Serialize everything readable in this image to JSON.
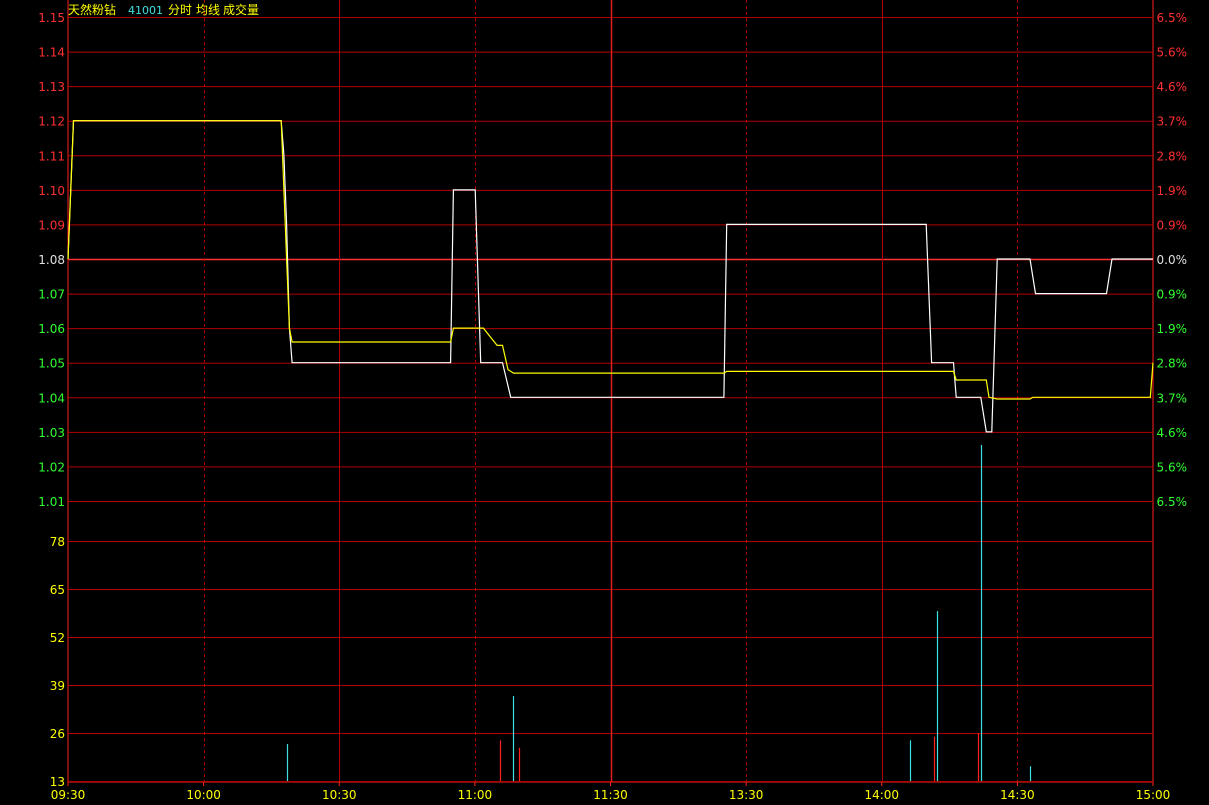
{
  "header": {
    "stock_name": "天然粉钻",
    "stock_code": "41001",
    "view_mode": "分时",
    "avg_line_label": "均线",
    "volume_label": "成交量"
  },
  "colors": {
    "grid": "#b00000",
    "axis": "#ff2020",
    "up": "#ff3030",
    "down": "#30ff30",
    "neutral": "#e0e0e0",
    "price_line": "#ffffff",
    "avg_line": "#ffff00",
    "vol_up": "#ff2020",
    "vol_down": "#40e0e0",
    "volume_tick": "#ffff00",
    "header_name": "#ffff00",
    "header_code": "#40e0e0",
    "header_text": "#ffff00"
  },
  "chart_data": {
    "type": "line",
    "prev_close": 1.08,
    "x_ticks": [
      "09:30",
      "10:00",
      "10:30",
      "11:00",
      "11:30",
      "13:30",
      "14:00",
      "14:30",
      "15:00"
    ],
    "y_ticks_price": [
      1.15,
      1.14,
      1.13,
      1.12,
      1.11,
      1.1,
      1.09,
      1.08,
      1.07,
      1.06,
      1.05,
      1.04,
      1.03,
      1.02,
      1.01
    ],
    "y_ticks_pct": [
      "6.5%",
      "5.6%",
      "4.6%",
      "3.7%",
      "2.8%",
      "1.9%",
      "0.9%",
      "0.0%",
      "0.9%",
      "1.9%",
      "2.8%",
      "3.7%",
      "4.6%",
      "5.6%",
      "6.5%"
    ],
    "ylim": [
      1.01,
      1.15
    ],
    "volume_ticks": [
      78,
      65,
      52,
      39,
      26,
      13
    ],
    "volume_max": 91,
    "series": [
      {
        "points": [
          [
            0,
            1.08
          ],
          [
            2,
            1.12
          ],
          [
            78,
            1.12
          ],
          [
            79,
            1.11
          ],
          [
            80,
            1.09
          ],
          [
            81,
            1.06
          ],
          [
            82,
            1.05
          ],
          [
            140,
            1.05
          ],
          [
            141,
            1.1
          ],
          [
            149,
            1.1
          ],
          [
            151,
            1.05
          ],
          [
            159,
            1.05
          ],
          [
            162,
            1.04
          ],
          [
            240,
            1.04
          ],
          [
            241,
            1.09
          ],
          [
            314,
            1.09
          ],
          [
            316,
            1.05
          ],
          [
            324,
            1.05
          ],
          [
            325,
            1.04
          ],
          [
            334,
            1.04
          ],
          [
            336,
            1.03
          ],
          [
            338,
            1.03
          ],
          [
            340,
            1.08
          ],
          [
            352,
            1.08
          ],
          [
            354,
            1.07
          ],
          [
            380,
            1.07
          ],
          [
            382,
            1.08
          ],
          [
            397,
            1.08
          ]
        ]
      },
      {
        "points": [
          [
            0,
            1.08
          ],
          [
            2,
            1.12
          ],
          [
            78,
            1.12
          ],
          [
            79,
            1.1
          ],
          [
            80,
            1.08
          ],
          [
            81,
            1.06
          ],
          [
            82,
            1.056
          ],
          [
            140,
            1.056
          ],
          [
            141,
            1.06
          ],
          [
            152,
            1.06
          ],
          [
            153,
            1.059
          ],
          [
            157,
            1.055
          ],
          [
            159,
            1.055
          ],
          [
            161,
            1.048
          ],
          [
            163,
            1.047
          ],
          [
            240,
            1.047
          ],
          [
            241,
            1.0475
          ],
          [
            324,
            1.0475
          ],
          [
            325,
            1.045
          ],
          [
            336,
            1.045
          ],
          [
            337,
            1.04
          ],
          [
            340,
            1.0395
          ],
          [
            352,
            1.0395
          ],
          [
            353,
            1.04
          ],
          [
            396,
            1.04
          ],
          [
            397,
            1.05
          ]
        ]
      }
    ],
    "volume": [
      {
        "t": 80,
        "v": 10,
        "dir": "down"
      },
      {
        "t": 158,
        "v": 11,
        "dir": "up"
      },
      {
        "t": 163,
        "v": 23,
        "dir": "down"
      },
      {
        "t": 165,
        "v": 9,
        "dir": "up"
      },
      {
        "t": 308,
        "v": 11,
        "dir": "down"
      },
      {
        "t": 317,
        "v": 12,
        "dir": "up"
      },
      {
        "t": 318,
        "v": 46,
        "dir": "down"
      },
      {
        "t": 333,
        "v": 13,
        "dir": "up"
      },
      {
        "t": 334,
        "v": 91,
        "dir": "down"
      },
      {
        "t": 352,
        "v": 4,
        "dir": "down"
      }
    ]
  }
}
